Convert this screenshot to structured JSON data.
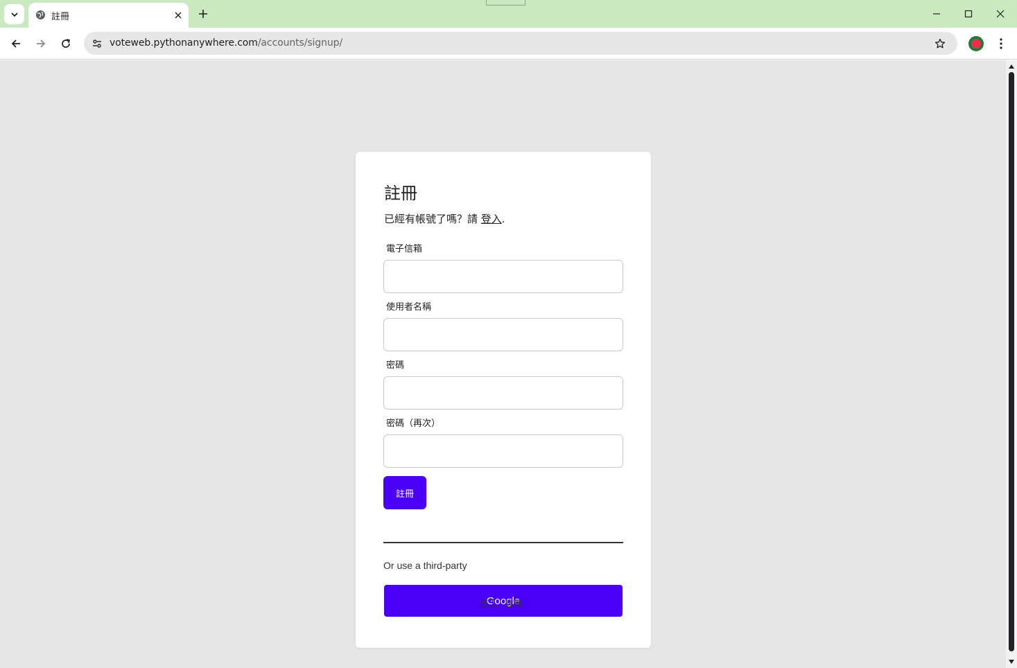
{
  "browser": {
    "tab_title": "註冊",
    "url_host": "voteweb.pythonanywhere.com",
    "url_path": "/accounts/signup/"
  },
  "page": {
    "title": "註冊",
    "subtitle_prefix": "已經有帳號了嗎？請 ",
    "subtitle_link": "登入",
    "subtitle_suffix": ".",
    "fields": [
      {
        "label": "電子信箱",
        "value": ""
      },
      {
        "label": "使用者名稱",
        "value": ""
      },
      {
        "label": "密碼",
        "value": ""
      },
      {
        "label": "密碼（再次）",
        "value": ""
      }
    ],
    "submit_label": "註冊",
    "third_party_text": "Or use a third-party",
    "google_label": "Google",
    "footer_links": [
      "登入",
      "註冊"
    ]
  },
  "colors": {
    "accent": "#4a00f6",
    "titlebar": "#cbe9c0",
    "page_background": "#e5e6e5"
  }
}
